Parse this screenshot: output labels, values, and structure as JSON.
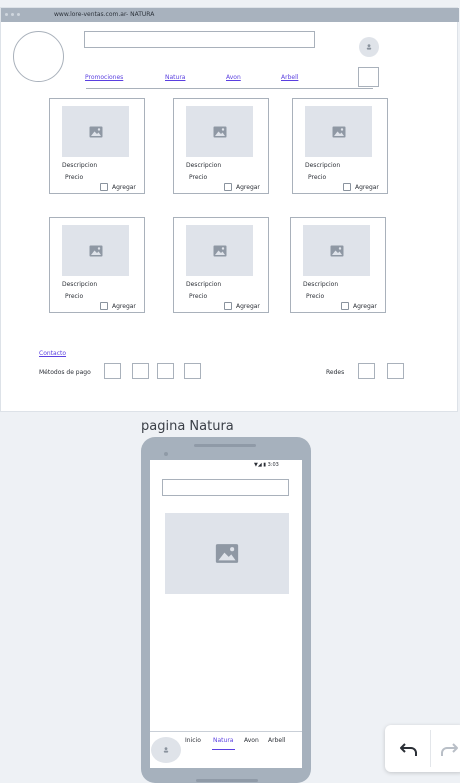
{
  "browser": {
    "url": "www.lore-ventas.com.ar-  NATURA"
  },
  "nav": {
    "links": [
      "Promociones",
      "Natura",
      "Avon",
      "Arbell"
    ]
  },
  "products": [
    {
      "description": "Descripcion",
      "price": "Precio",
      "add_label": "Agregar"
    },
    {
      "description": "Descripcion",
      "price": "Precio",
      "add_label": "Agregar"
    },
    {
      "description": "Descripcion",
      "price": "Precio",
      "add_label": "Agregar"
    },
    {
      "description": "Descripcion",
      "price": "Precio",
      "add_label": "Agregar"
    },
    {
      "description": "Descripcion",
      "price": "Precio",
      "add_label": "Agregar"
    },
    {
      "description": "Descripcion",
      "price": "Precio",
      "add_label": "Agregar"
    }
  ],
  "footer": {
    "contact": "Contacto",
    "payment_label": "Métodos de pago",
    "social_label": "Redes"
  },
  "mobile": {
    "title": "pagina Natura",
    "status": "▼◢ ▮ 3:03",
    "tabs": [
      "Inicio",
      "Natura",
      "Avon",
      "Arbell"
    ],
    "active_tab": "Natura"
  },
  "colors": {
    "accent": "#5a3fe0",
    "placeholder": "#dfe3ea",
    "frame": "#a8b2be"
  }
}
